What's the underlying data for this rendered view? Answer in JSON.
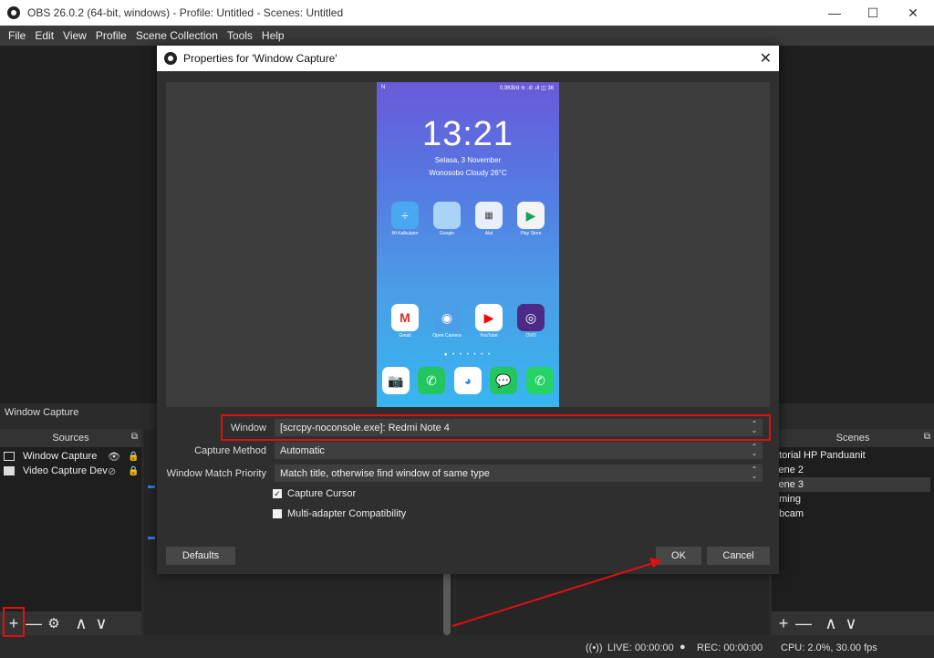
{
  "window": {
    "title": "OBS 26.0.2 (64-bit, windows) - Profile: Untitled - Scenes: Untitled",
    "minimize_glyph": "—",
    "maximize_glyph": "☐",
    "close_glyph": "✕"
  },
  "menu": [
    "File",
    "Edit",
    "View",
    "Profile",
    "Scene Collection",
    "Tools",
    "Help"
  ],
  "selected_source_label": "Window Capture",
  "sources": {
    "header": "Sources",
    "items": [
      {
        "label": "Window Capture",
        "icon": "window-icon"
      },
      {
        "label": "Video Capture Dev",
        "icon": "camera-icon"
      }
    ]
  },
  "scenes": {
    "header": "Scenes",
    "items": [
      "utorial HP Panduanit",
      "cene 2",
      "cene 3",
      "aming",
      "ebcam"
    ],
    "selected_index": 2
  },
  "footer_buttons": {
    "add": "+",
    "remove": "—",
    "settings": "⚙",
    "up": "∧",
    "down": "∨"
  },
  "status": {
    "live": "LIVE: 00:00:00",
    "rec": "REC: 00:00:00",
    "cpu": "CPU: 2.0%, 30.00 fps"
  },
  "dialog": {
    "title": "Properties for 'Window Capture'",
    "close_glyph": "✕",
    "preview": {
      "status_left": "N",
      "status_right": "0,9KB/d ≋ .ıll .ıll ◫ 36",
      "clock": "13:21",
      "date": "Selasa, 3 November",
      "weather": "Wonosobo Cloudy 26°C",
      "apps_row1": [
        {
          "label": "Mi Kalkulator",
          "icon": "calculator-icon",
          "color": "#4aa8f0"
        },
        {
          "label": "Google",
          "icon": "folder-icon",
          "color": "#a9d4f5"
        },
        {
          "label": "Alat",
          "icon": "tools-folder-icon",
          "color": "#e8eefa"
        },
        {
          "label": "Play Store",
          "icon": "play-store-icon",
          "color": "#f4f4f4"
        }
      ],
      "apps_row2": [
        {
          "label": "Gmail",
          "icon": "gmail-icon",
          "color": "#ffffff"
        },
        {
          "label": "Open Camera",
          "icon": "camera-app-icon",
          "color": "#4b9de6"
        },
        {
          "label": "YouTube",
          "icon": "youtube-icon",
          "color": "#ffffff"
        },
        {
          "label": "OVO",
          "icon": "ovo-icon",
          "color": "#4c2a86"
        }
      ],
      "dock": [
        {
          "icon": "camera-dock-icon",
          "color": "#ffffff"
        },
        {
          "icon": "phone-dock-icon",
          "color": "#22c55e"
        },
        {
          "icon": "chrome-dock-icon",
          "color": "#ffffff"
        },
        {
          "icon": "messages-dock-icon",
          "color": "#22c55e"
        },
        {
          "icon": "whatsapp-dock-icon",
          "color": "#25d366"
        }
      ],
      "page_dots": "● • • • • • •"
    },
    "properties": {
      "window_label": "Window",
      "window_value": "[scrcpy-noconsole.exe]: Redmi Note 4",
      "capture_method_label": "Capture Method",
      "capture_method_value": "Automatic",
      "match_priority_label": "Window Match Priority",
      "match_priority_value": "Match title, otherwise find window of same type",
      "capture_cursor_label": "Capture Cursor",
      "capture_cursor_checked": true,
      "multi_adapter_label": "Multi-adapter Compatibility",
      "multi_adapter_checked": false
    },
    "buttons": {
      "defaults": "Defaults",
      "ok": "OK",
      "cancel": "Cancel"
    }
  },
  "annotation_color": "#e01010"
}
